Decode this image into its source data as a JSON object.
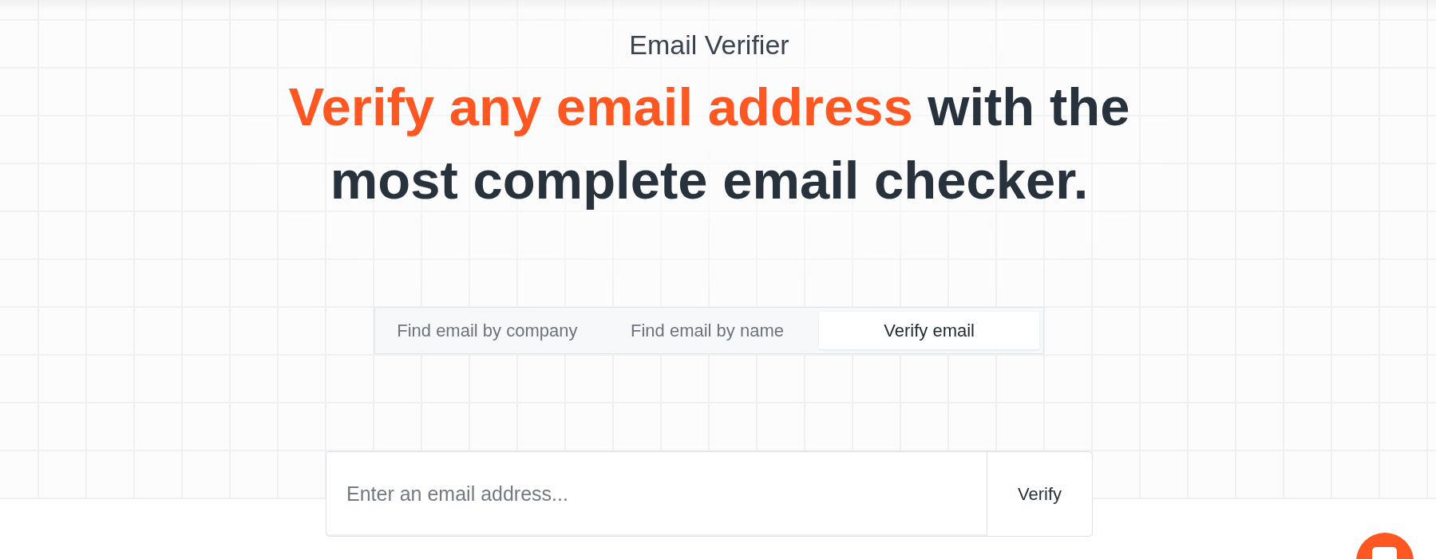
{
  "header": {
    "eyebrow": "Email Verifier",
    "headline": {
      "highlight": "Verify any email address",
      "rest": "with the most complete email checker."
    }
  },
  "tabs": [
    {
      "label": "Find email by company",
      "selected": false
    },
    {
      "label": "Find email by name",
      "selected": false
    },
    {
      "label": "Verify email",
      "selected": true
    }
  ],
  "form": {
    "placeholder": "Enter an email address...",
    "button": "Verify"
  }
}
